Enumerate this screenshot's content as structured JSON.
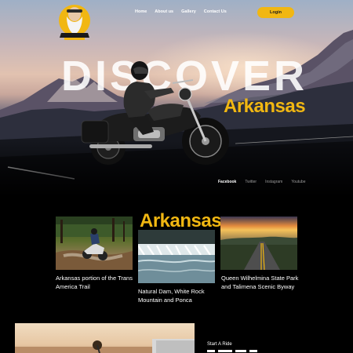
{
  "brand": {
    "logo_text": "ARKANSAS"
  },
  "nav": {
    "items": [
      "Home",
      "About us",
      "Gallery",
      "Contact Us"
    ],
    "login_label": "Login"
  },
  "hero": {
    "headline": "DISCOVER",
    "subheadline": "Arkansas"
  },
  "social": {
    "items": [
      "Facebook",
      "Twitter",
      "Instagram",
      "Youtube"
    ],
    "active": "Facebook"
  },
  "section": {
    "title": "Arkansas"
  },
  "cards": [
    {
      "title": "Arkansas portion of the Trans America Trail"
    },
    {
      "title": "Natural Dam, White Rock Mountain and Ponca"
    },
    {
      "title": "Queen Wilhelmina State Park and Talimena Scenic Byway"
    }
  ],
  "bottom": {
    "label": "Start A Ride"
  },
  "colors": {
    "accent": "#f1b712",
    "background": "#000000",
    "text": "#ffffff",
    "muted": "#9a9a9a"
  }
}
